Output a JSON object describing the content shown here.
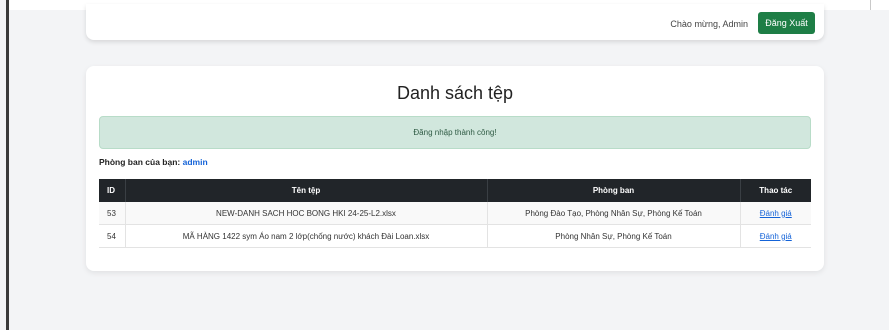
{
  "header": {
    "welcome_text": "Chào mừng, Admin",
    "logout_label": "Đăng Xuất"
  },
  "main": {
    "title": "Danh sách tệp",
    "alert_text": "Đăng nhập thành công!",
    "dept_label": "Phòng ban của bạn:",
    "dept_value": "admin"
  },
  "table": {
    "columns": [
      "ID",
      "Tên tệp",
      "Phòng ban",
      "Thao tác"
    ],
    "rows": [
      {
        "id": "53",
        "file": "NEW-DANH SACH HOC BONG HKI 24-25-L2.xlsx",
        "dept": "Phòng Đào Tạo, Phòng Nhân Sự, Phòng Kế Toán",
        "action": "Đánh giá"
      },
      {
        "id": "54",
        "file": "MÃ HÀNG 1422 sym Áo nam 2 lớp(chống nước) khách Đài Loan.xlsx",
        "dept": "Phòng Nhân Sự, Phòng Kế Toán",
        "action": "Đánh giá"
      }
    ]
  },
  "colors": {
    "accent_green": "#1e7e46",
    "alert_bg": "#d1e7dd",
    "table_header_bg": "#212529",
    "link": "#1463d8"
  }
}
